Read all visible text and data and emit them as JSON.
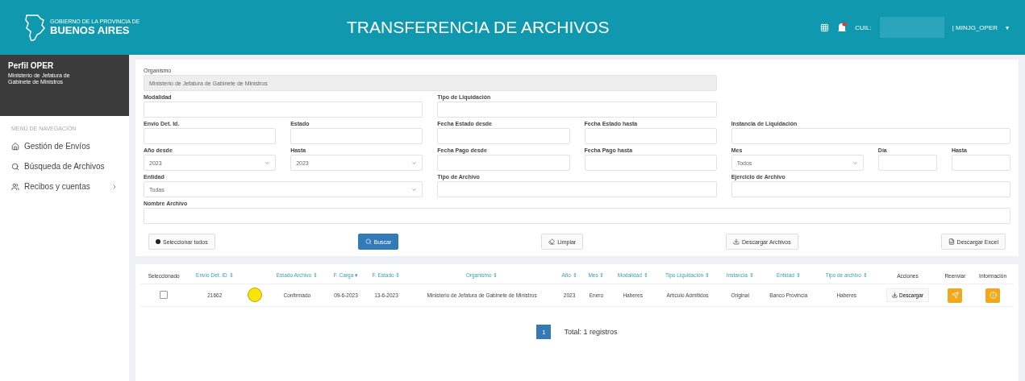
{
  "header": {
    "logo_small": "GOBIERNO DE LA PROVINCIA DE",
    "logo_big": "BUENOS AIRES",
    "title": "TRANSFERENCIA DE ARCHIVOS",
    "notification": true,
    "user_label": "CUIL:",
    "user_role": "| MINJG_OPER",
    "user_caret": "▾"
  },
  "sidebar": {
    "profile": "Perfil OPER",
    "organization": "Ministerio de Jefatura de Gabinete de Ministros",
    "section": "MENÚ DE NAVEGACIÓN",
    "items": [
      {
        "label": "Gestión de Envíos",
        "has_children": false
      },
      {
        "label": "Búsqueda de Archivos",
        "has_children": false
      },
      {
        "label": "Recibos y cuentas",
        "has_children": true
      }
    ]
  },
  "filters": [
    [
      {
        "label": "Organismo",
        "kind": "disabled",
        "value": "Ministerio de Jefatura de Gabinete de Ministros"
      }
    ],
    [
      {
        "label": "Modalidad",
        "kind": "text"
      },
      {
        "label": "Tipo de Liquidación",
        "kind": "text"
      }
    ],
    [
      {
        "label": "Envío Det. Id.",
        "kind": "text"
      },
      {
        "label": "Estado",
        "kind": "text"
      },
      {
        "label": "Fecha Estado desde",
        "kind": "text"
      },
      {
        "label": "Fecha Estado hasta",
        "kind": "text"
      },
      {
        "label": "Instancia de Liquidación",
        "kind": "text"
      }
    ],
    [
      {
        "label": "Año desde",
        "kind": "select",
        "value": "2023"
      },
      {
        "label": "Hasta",
        "kind": "select",
        "value": "2023"
      },
      {
        "label": "Fecha Pago desde",
        "kind": "text"
      },
      {
        "label": "Fecha Pago hasta",
        "kind": "text"
      },
      {
        "label": "Mes",
        "kind": "select",
        "value": "Todos"
      },
      {
        "label": "Día",
        "kind": "text"
      },
      {
        "label": "Hasta",
        "kind": "text"
      }
    ],
    [
      {
        "label": "Entidad",
        "kind": "select",
        "value": "Todas"
      },
      {
        "label": "Tipo de Archivo",
        "kind": "text"
      },
      {
        "label": "Ejercicio de Archivo",
        "kind": "text"
      }
    ],
    [
      {
        "label": "Nombre Archivo",
        "kind": "text"
      }
    ]
  ],
  "actions": [
    {
      "label": "Seleccionar todos",
      "kind": "plain"
    },
    {
      "label": "Buscar",
      "kind": "primary"
    },
    {
      "label": "Limpiar",
      "kind": "plain"
    },
    {
      "label": "Descargar Archivos",
      "kind": "plain"
    },
    {
      "label": "Descargar Excel",
      "kind": "plain"
    }
  ],
  "table": {
    "columns": [
      "Seleccionado",
      "Envío Det. ID ⇕",
      "",
      "Estado Archivo ⇕",
      "F. Carga ▾",
      "F. Estado ⇕",
      "Organismo ⇕",
      "Año ⇕",
      "Mes ⇕",
      "Modalidad ⇕",
      "Tipo Liquidación ⇕",
      "Instancia ⇕",
      "Entidad ⇕",
      "Tipo de archivo ⇕",
      "Acciones",
      "Reenviar",
      "Información"
    ],
    "rows": [
      {
        "checked": false,
        "color": "#f5e50a",
        "cells": [
          "",
          "21662",
          "",
          "Confirmado",
          "09-6-2023",
          "13-6-2023",
          "Ministerio de Jefatura de Gabinete de Ministros",
          "2023",
          "Enero",
          "Haberes",
          "Artículo Admitidos",
          "Original",
          "Banco Provincia",
          "Haberes",
          "Descargar"
        ]
      }
    ]
  },
  "pagination": {
    "pages": [
      {
        "label": "1",
        "selected": true
      }
    ],
    "total": "Total: 1 registros"
  }
}
